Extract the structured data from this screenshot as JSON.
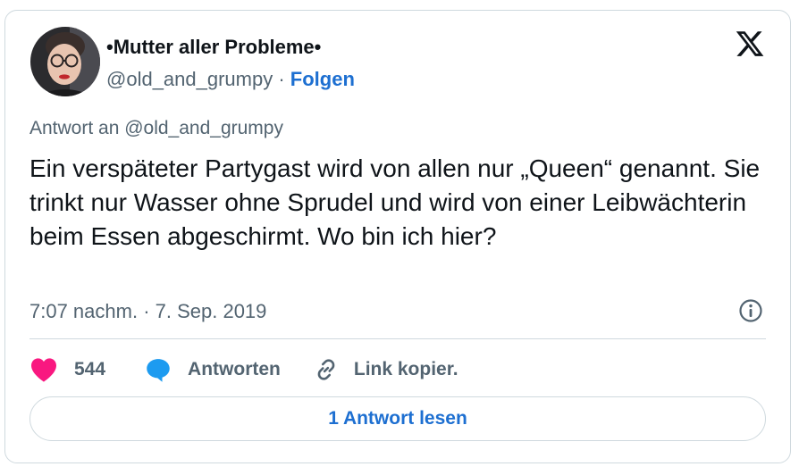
{
  "author": {
    "display_name": "•Mutter aller Probleme•",
    "handle": "@old_and_grumpy",
    "separator": " · ",
    "follow_label": "Folgen"
  },
  "tweet": {
    "reply_to": "Antwort an @old_and_grumpy",
    "text": "Ein verspäteter Partygast wird von allen nur „Queen“ genannt. Sie trinkt nur Wasser ohne Sprudel und wird von einer Leibwächterin beim Essen abgeschirmt. Wo bin ich hier?",
    "timestamp": "7:07 nachm. · 7. Sep. 2019"
  },
  "actions": {
    "like_count": "544",
    "reply_label": "Antworten",
    "copy_link_label": "Link kopier."
  },
  "read_replies_label": "1 Antwort lesen",
  "colors": {
    "accent": "#1d6fd1",
    "like": "#f91880",
    "reply_bubble": "#1d9bf0",
    "muted_text": "#536471",
    "border": "#cfd9de"
  },
  "icons": {
    "logo": "x-logo-icon",
    "info": "info-icon",
    "like": "heart-icon",
    "reply": "speech-bubble-icon",
    "copy_link": "link-icon"
  }
}
